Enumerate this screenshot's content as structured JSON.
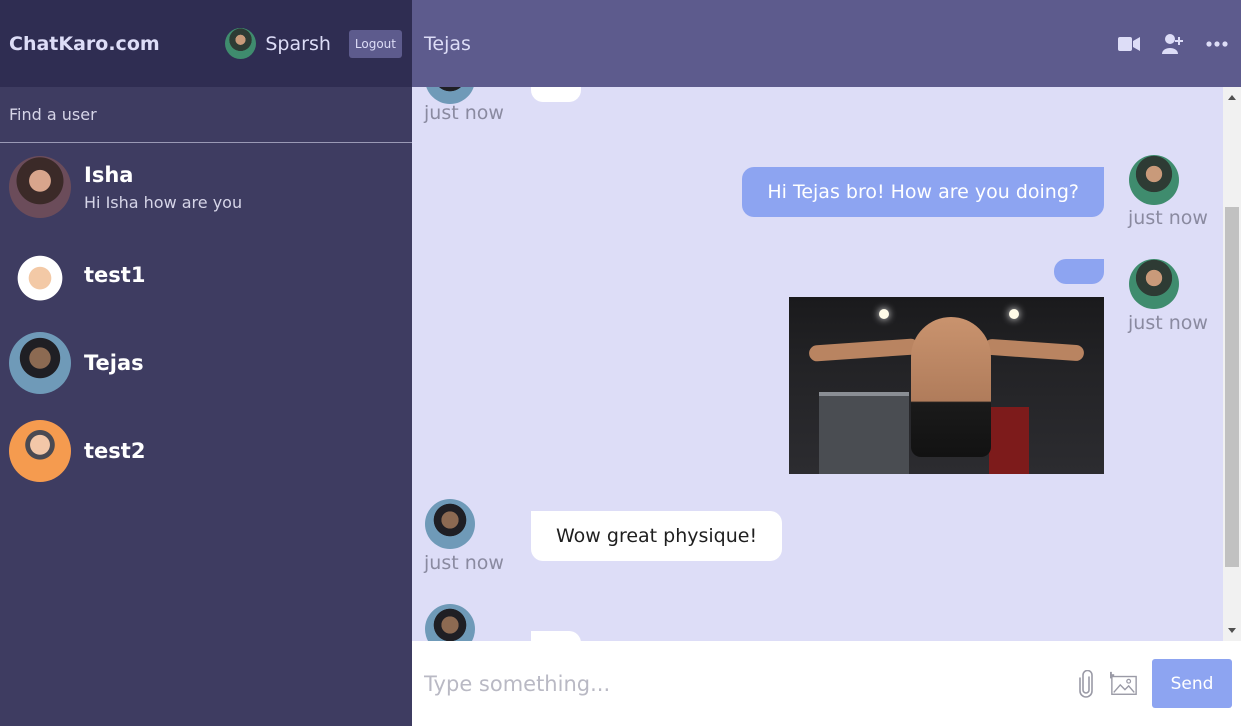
{
  "navbar": {
    "logo": "ChatKaro.com",
    "user_name": "Sparsh",
    "logout_label": "Logout"
  },
  "search": {
    "placeholder": "Find a user"
  },
  "chats": [
    {
      "name": "Isha",
      "last_message": "Hi Isha how are you"
    },
    {
      "name": "test1",
      "last_message": ""
    },
    {
      "name": "Tejas",
      "last_message": ""
    },
    {
      "name": "test2",
      "last_message": ""
    }
  ],
  "chat_header": {
    "title": "Tejas",
    "icons": [
      "video-camera-icon",
      "add-user-icon",
      "more-options-icon"
    ]
  },
  "messages": [
    {
      "owner": "Tejas",
      "time": "just now",
      "text": ""
    },
    {
      "owner": "Sparsh",
      "time": "just now",
      "text": "Hi Tejas bro! How are you doing?"
    },
    {
      "owner": "Sparsh",
      "time": "just now",
      "text": "",
      "image": "gym-physique-photo"
    },
    {
      "owner": "Tejas",
      "time": "just now",
      "text": "Wow great physique!"
    },
    {
      "owner": "Tejas",
      "time": "",
      "text": ""
    }
  ],
  "input": {
    "placeholder": "Type something...",
    "send_label": "Send"
  },
  "colors": {
    "sidebar": "#3e3c61",
    "navbar": "#2f2d52",
    "header": "#5d5b8d",
    "chat_bg": "#ddddf7",
    "outgoing_bubble": "#8da4f1"
  }
}
